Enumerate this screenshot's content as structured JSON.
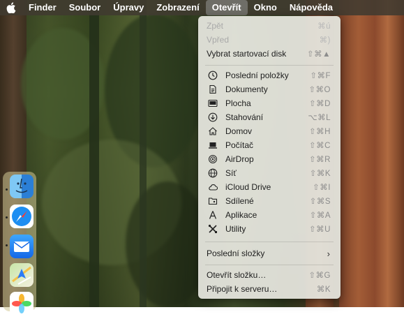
{
  "menubar": {
    "apple_icon": "apple-logo-icon",
    "items": [
      "Finder",
      "Soubor",
      "Úpravy",
      "Zobrazení",
      "Otevřít",
      "Okno",
      "Nápověda"
    ],
    "active": "Otevřít"
  },
  "menu": {
    "top_items": [
      {
        "label": "Zpět",
        "shortcut": "⌘ú",
        "enabled": false
      },
      {
        "label": "Vpřed",
        "shortcut": "⌘)",
        "enabled": false
      },
      {
        "label": "Vybrat startovací disk",
        "shortcut": "⇧⌘▲",
        "enabled": true
      }
    ],
    "places": [
      {
        "label": "Poslední položky",
        "shortcut": "⇧⌘F",
        "icon": "clock-icon"
      },
      {
        "label": "Dokumenty",
        "shortcut": "⇧⌘O",
        "icon": "document-icon"
      },
      {
        "label": "Plocha",
        "shortcut": "⇧⌘D",
        "icon": "desktop-icon"
      },
      {
        "label": "Stahování",
        "shortcut": "⌥⌘L",
        "icon": "download-icon"
      },
      {
        "label": "Domov",
        "shortcut": "⇧⌘H",
        "icon": "home-icon"
      },
      {
        "label": "Počítač",
        "shortcut": "⇧⌘C",
        "icon": "laptop-icon"
      },
      {
        "label": "AirDrop",
        "shortcut": "⇧⌘R",
        "icon": "airdrop-icon"
      },
      {
        "label": "Síť",
        "shortcut": "⇧⌘K",
        "icon": "network-icon"
      },
      {
        "label": "iCloud Drive",
        "shortcut": "⇧⌘I",
        "icon": "cloud-icon"
      },
      {
        "label": "Sdílené",
        "shortcut": "⇧⌘S",
        "icon": "shared-folder-icon"
      },
      {
        "label": "Aplikace",
        "shortcut": "⇧⌘A",
        "icon": "applications-icon"
      },
      {
        "label": "Utility",
        "shortcut": "⇧⌘U",
        "icon": "utilities-icon"
      }
    ],
    "recent_folders": {
      "label": "Poslední složky",
      "icon": "chevron-right-icon"
    },
    "bottom_items": [
      {
        "label": "Otevřít složku…",
        "shortcut": "⇧⌘G"
      },
      {
        "label": "Připojit k serveru…",
        "shortcut": "⌘K"
      }
    ]
  },
  "dock": {
    "apps": [
      "finder-icon",
      "safari-icon",
      "mail-icon",
      "maps-icon",
      "photos-icon"
    ]
  }
}
